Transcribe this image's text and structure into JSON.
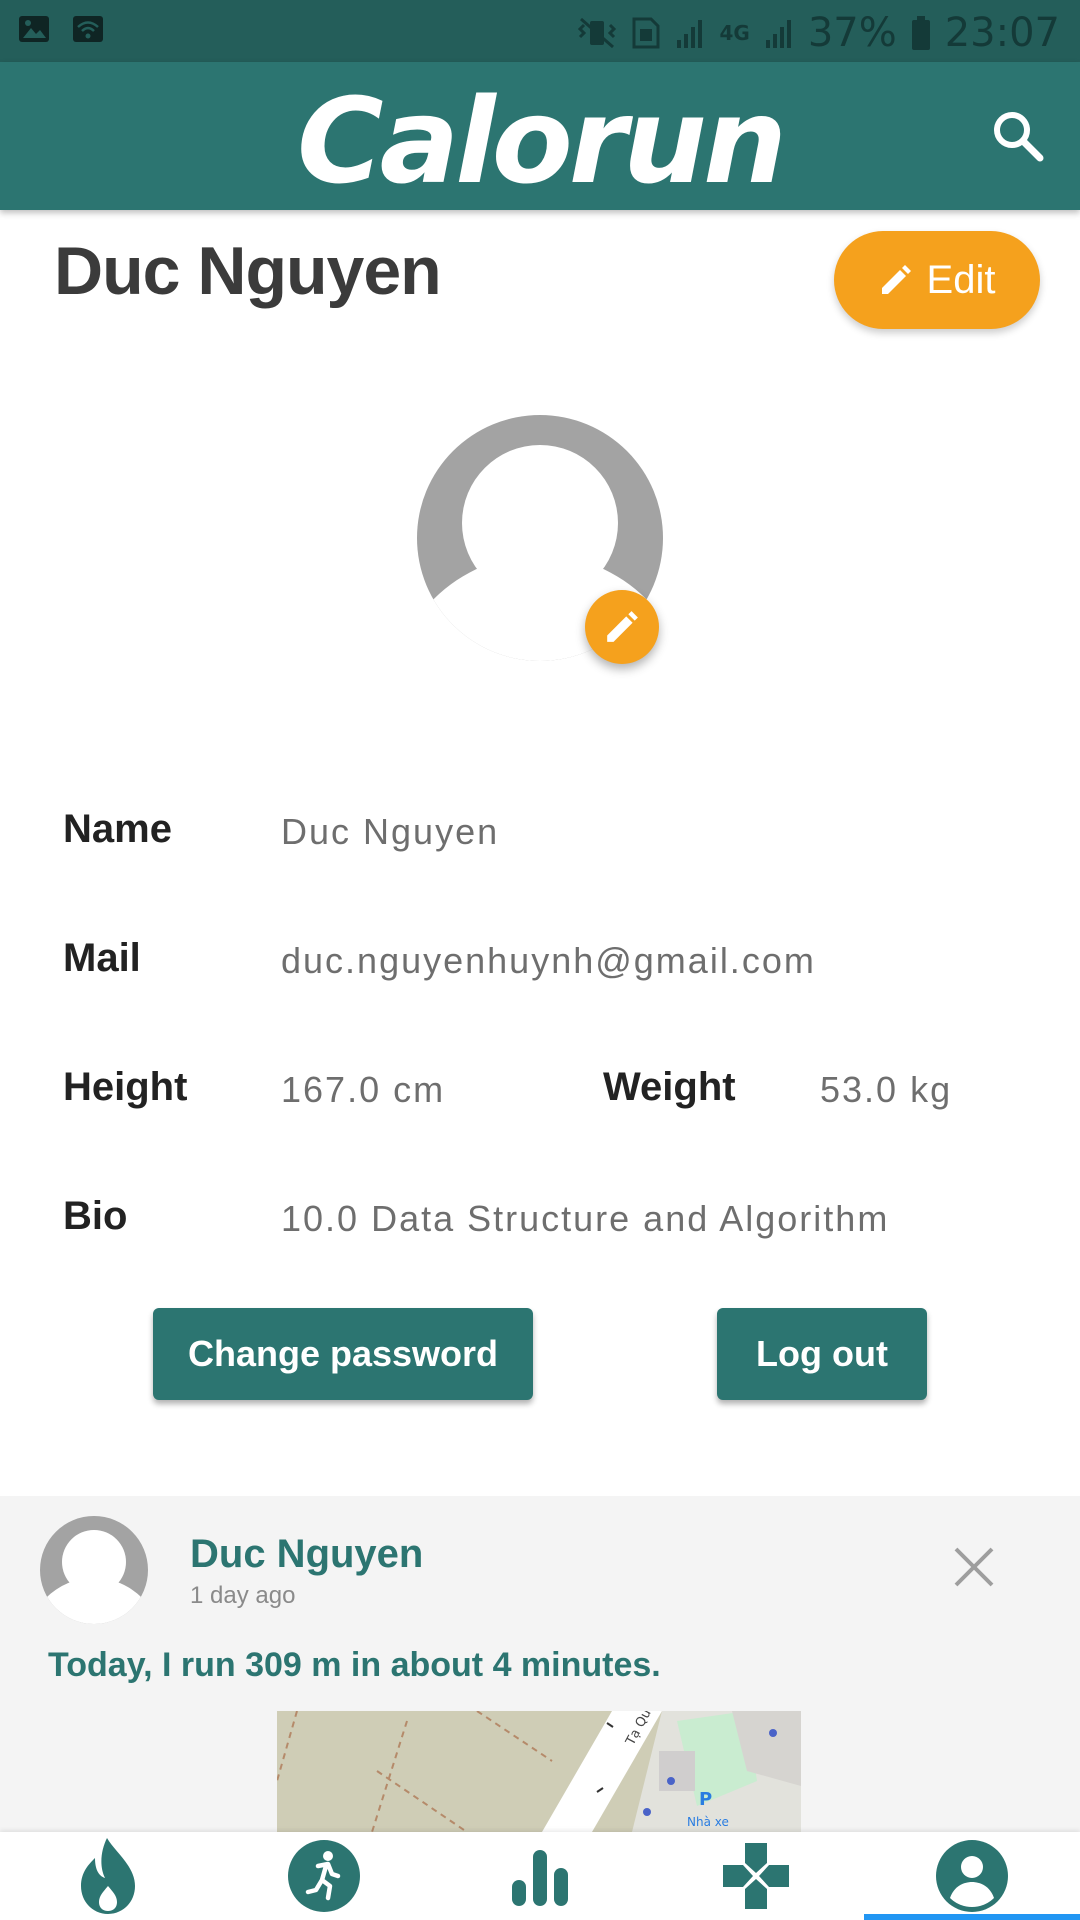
{
  "status_bar": {
    "battery": "37%",
    "time": "23:07",
    "network": "4G"
  },
  "app_bar": {
    "logo": "Calorun",
    "search_icon": "search-icon"
  },
  "profile": {
    "title": "Duc Nguyen",
    "edit_label": "Edit",
    "fields": {
      "name_label": "Name",
      "name_value": "Duc Nguyen",
      "mail_label": "Mail",
      "mail_value": "duc.nguyenhuynh@gmail.com",
      "height_label": "Height",
      "height_value": "167.0 cm",
      "weight_label": "Weight",
      "weight_value": "53.0 kg",
      "bio_label": "Bio",
      "bio_value": "10.0 Data Structure and Algorithm"
    },
    "change_password_label": "Change password",
    "logout_label": "Log out"
  },
  "feed": {
    "author": "Duc Nguyen",
    "time": "1 day ago",
    "text": "Today, I run 309 m in about 4 minutes.",
    "map_labels": [
      "Tạ Quang",
      "Nhà xe"
    ]
  },
  "bottom_nav": {
    "items": [
      "flame-icon",
      "run-icon",
      "bar-chart-icon",
      "gamepad-icon",
      "account-icon"
    ],
    "active_index": 4
  },
  "colors": {
    "primary": "#2c7571",
    "accent": "#f5a11d",
    "status_bar": "#245e5a",
    "indicator": "#2196f3"
  }
}
